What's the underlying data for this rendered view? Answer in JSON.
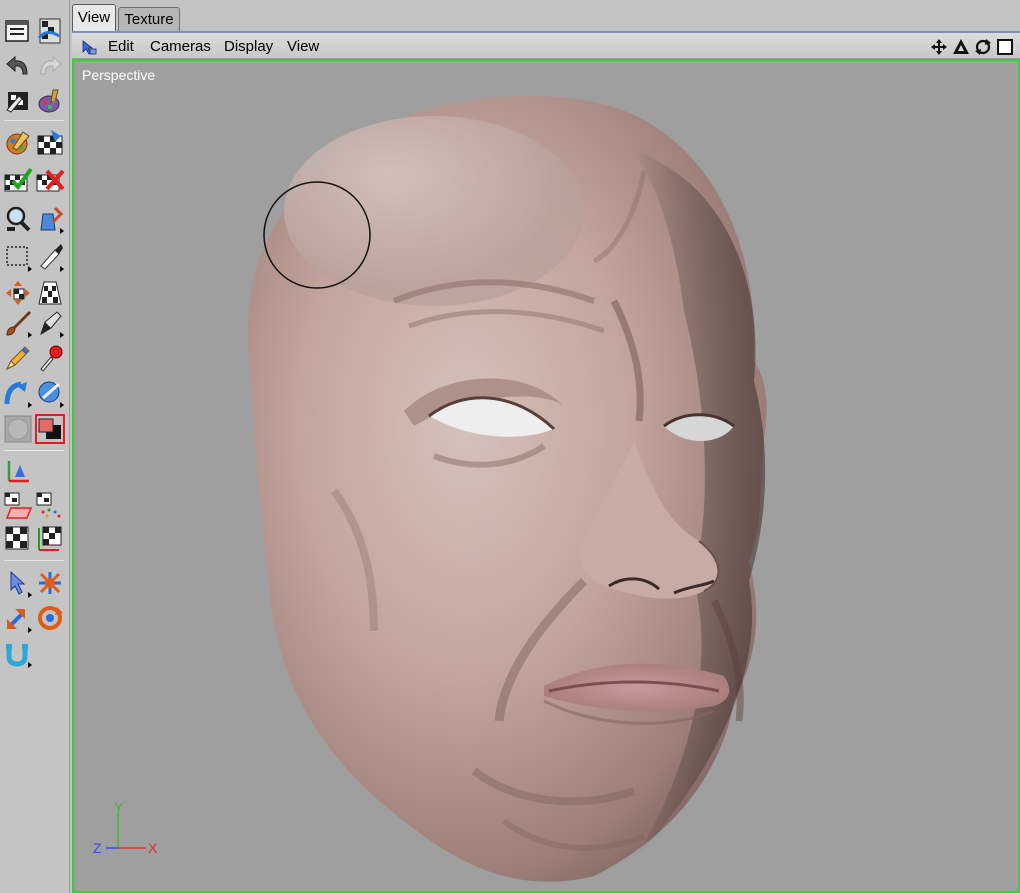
{
  "tabs": [
    {
      "label": "View",
      "active": true
    },
    {
      "label": "Texture",
      "active": false
    }
  ],
  "menu": {
    "items": [
      "Edit",
      "Cameras",
      "Display",
      "View"
    ]
  },
  "nav_icons": [
    "move-view-icon",
    "dolly-view-icon",
    "rotate-view-icon",
    "maximize-view-icon"
  ],
  "viewport": {
    "label": "Perspective",
    "axes": {
      "x": "X",
      "y": "Y",
      "z": "Z"
    }
  },
  "colors": {
    "viewport_border": "#35d235",
    "viewport_bg": "#9f9f9f",
    "axis_x": "#e03030",
    "axis_y": "#30c030",
    "axis_z": "#3050e0"
  },
  "toolbar": {
    "tools": [
      "layout-icon",
      "texture-view-icon",
      "undo-icon",
      "redo-icon",
      "bodypaint-wizard-icon",
      "paint-setup-icon",
      "material-paint-icon",
      "texture-checker-icon",
      "apply-texture-icon",
      "remove-texture-icon",
      "magnify-icon",
      "fill-bucket-icon",
      "rect-select-icon",
      "brush-tool-icon",
      "move-tool-icon",
      "checker-grid-icon",
      "paint-brush-icon",
      "eraser-icon",
      "pencil-icon",
      "eyedropper-icon",
      "projection-paint-icon",
      "smear-icon",
      "sphere-material-icon",
      "color-swatch-icon",
      "axis-tool-icon",
      "uv-polygon-icon",
      "uv-points-icon",
      "uv-checker-icon",
      "uv-transform-icon",
      "select-arrow-icon",
      "live-select-icon",
      "scale-tool-icon",
      "rotate-tool-icon",
      "magnet-tool-icon"
    ]
  }
}
